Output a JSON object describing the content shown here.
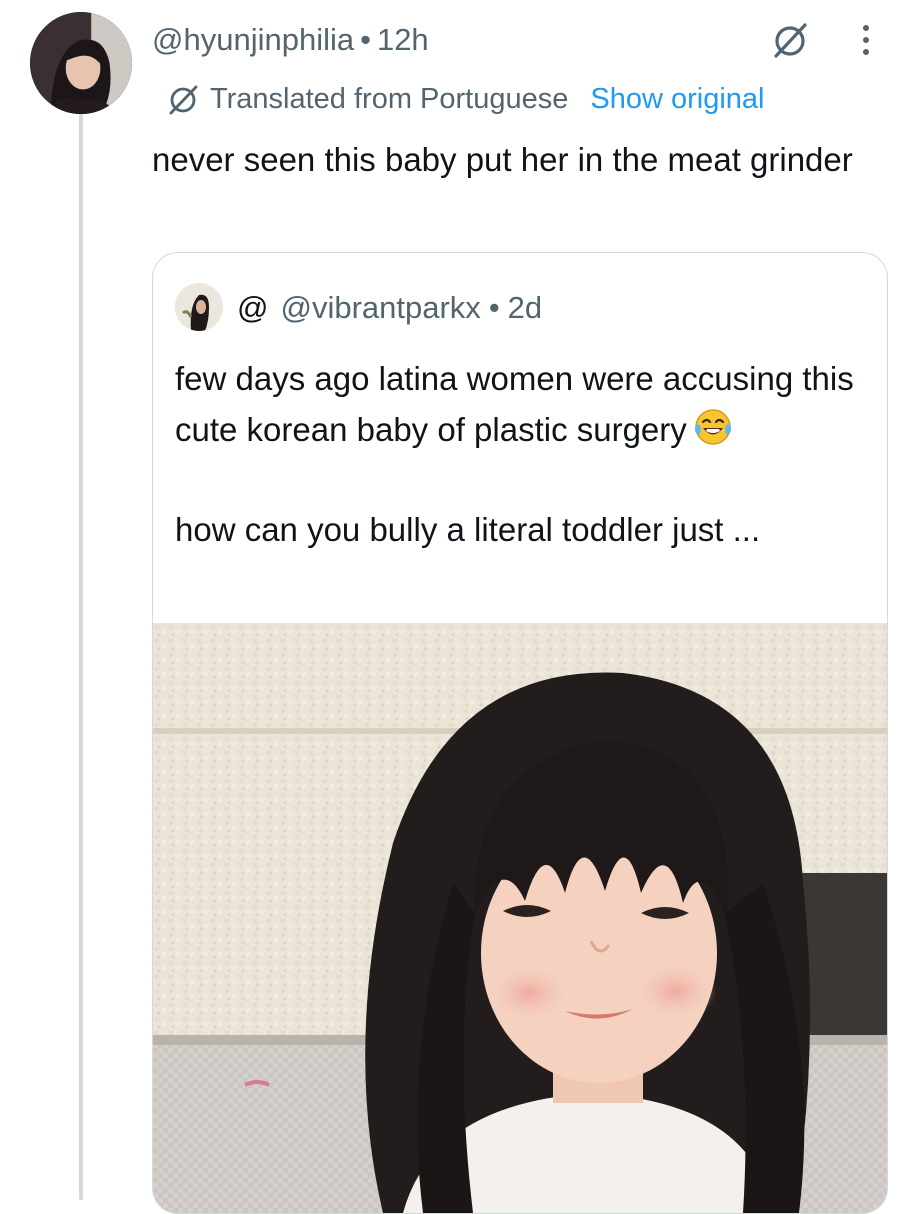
{
  "tweet": {
    "handle": "@hyunjinphilia",
    "separator": "•",
    "time": "12h",
    "translated_label": "Translated from Portuguese",
    "show_original_label": "Show original",
    "text": "never seen this baby put her in the meat grinder"
  },
  "quote": {
    "display_name": "@",
    "handle": "@vibrantparkx",
    "separator": "•",
    "time": "2d",
    "text_line1": "few days ago latina women were accusing this cute korean baby of plastic surgery",
    "emoji": "face-with-tears-of-joy",
    "text_line2": "how can you bully a literal toddler just ..."
  },
  "colors": {
    "text_primary": "#0f1419",
    "text_secondary": "#536471",
    "link": "#1d9bf0",
    "border": "#cfd9de"
  }
}
